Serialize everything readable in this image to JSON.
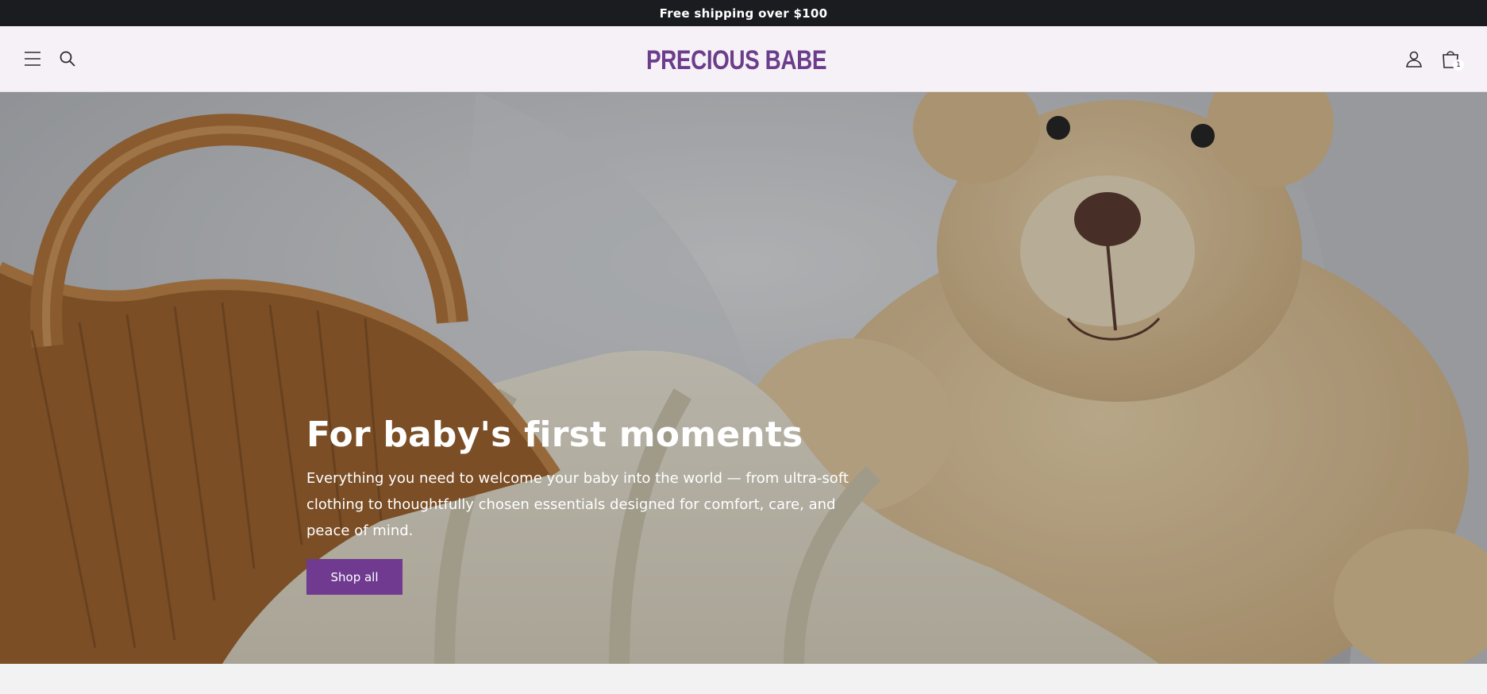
{
  "announcement": {
    "text": "Free shipping over $100"
  },
  "header": {
    "logo_text": "PRECIOUS BABE",
    "cart_count": "1",
    "icons": {
      "menu": "hamburger-menu-icon",
      "search": "search-icon",
      "account": "user-icon",
      "cart": "shopping-bag-icon",
      "logo": "elephant-logo-icon"
    }
  },
  "hero": {
    "title": "For baby's first moments",
    "text": "Everything you need to welcome your baby into the world — from ultra-soft clothing to thoughtfully chosen essentials designed for comfort, care, and peace of mind.",
    "button_label": "Shop all"
  },
  "colors": {
    "accent": "#6f3a8f",
    "brand_text": "#6b3d8c",
    "announcement_bg": "#1b1c20",
    "header_bg": "#f6f1f6"
  }
}
